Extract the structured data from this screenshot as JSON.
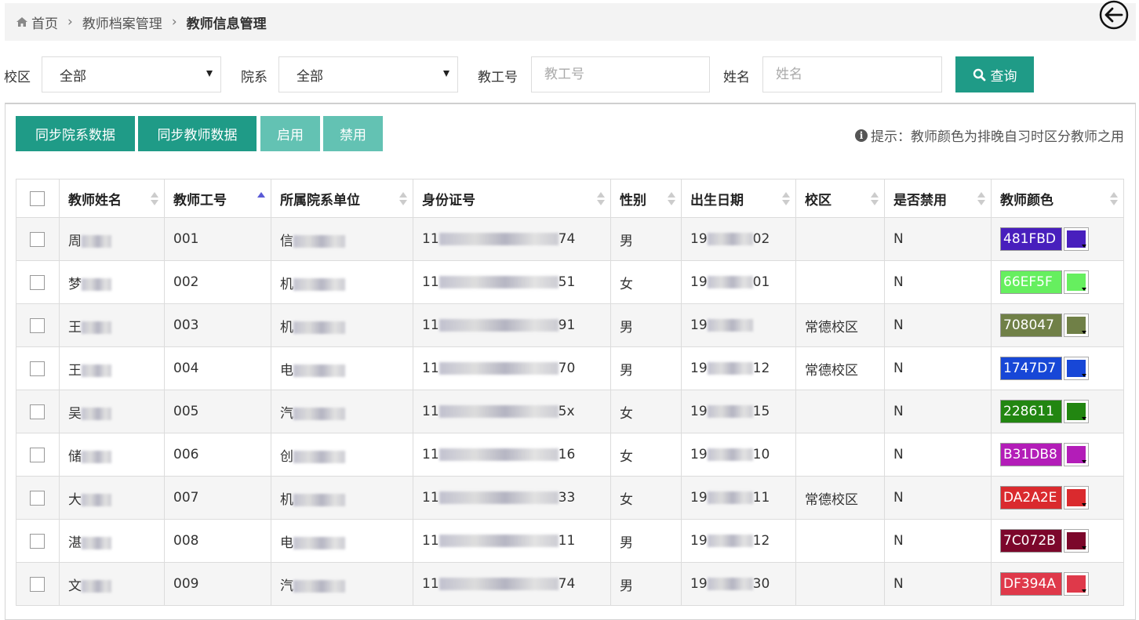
{
  "breadcrumb": {
    "home": "首页",
    "section": "教师档案管理",
    "current": "教师信息管理"
  },
  "filters": {
    "campus_label": "校区",
    "campus_value": "全部",
    "dept_label": "院系",
    "dept_value": "全部",
    "id_label": "教工号",
    "id_placeholder": "教工号",
    "name_label": "姓名",
    "name_placeholder": "姓名",
    "search_label": "查询"
  },
  "toolbar": {
    "sync_dept": "同步院系数据",
    "sync_teacher": "同步教师数据",
    "enable": "启用",
    "disable": "禁用",
    "tip": "提示：教师颜色为排晚自习时区分教师之用"
  },
  "table": {
    "columns": [
      "教师姓名",
      "教师工号",
      "所属院系单位",
      "身份证号",
      "性别",
      "出生日期",
      "校区",
      "是否禁用",
      "教师颜色"
    ],
    "sorted_column": "教师工号",
    "rows": [
      {
        "name": "周",
        "id": "001",
        "dept": "信",
        "idcard_prefix": "11",
        "idcard_suffix": "74",
        "gender": "男",
        "birth_prefix": "19",
        "birth_suffix": "02",
        "campus": "",
        "disabled": "N",
        "color": "481FBD",
        "hex": "#481FBD"
      },
      {
        "name": "梦",
        "id": "002",
        "dept": "机",
        "idcard_prefix": "11",
        "idcard_suffix": "51",
        "gender": "女",
        "birth_prefix": "19",
        "birth_suffix": "01",
        "campus": "",
        "disabled": "N",
        "color": "66EF5F",
        "hex": "#66EF5F"
      },
      {
        "name": "王",
        "id": "003",
        "dept": "机",
        "idcard_prefix": "11",
        "idcard_suffix": "91",
        "gender": "男",
        "birth_prefix": "19",
        "birth_suffix": "",
        "campus": "常德校区",
        "disabled": "N",
        "color": "708047",
        "hex": "#708047"
      },
      {
        "name": "王",
        "id": "004",
        "dept": "电",
        "idcard_prefix": "11",
        "idcard_suffix": "70",
        "gender": "男",
        "birth_prefix": "19",
        "birth_suffix": "12",
        "campus": "常德校区",
        "disabled": "N",
        "color": "1747D7",
        "hex": "#1747D7"
      },
      {
        "name": "吴",
        "id": "005",
        "dept": "汽",
        "idcard_prefix": "11",
        "idcard_suffix": "5x",
        "gender": "女",
        "birth_prefix": "19",
        "birth_suffix": "15",
        "campus": "",
        "disabled": "N",
        "color": "228611",
        "hex": "#228611"
      },
      {
        "name": "储",
        "id": "006",
        "dept": "创",
        "idcard_prefix": "11",
        "idcard_suffix": "16",
        "gender": "女",
        "birth_prefix": "19",
        "birth_suffix": "10",
        "campus": "",
        "disabled": "N",
        "color": "B31DB8",
        "hex": "#B31DB8"
      },
      {
        "name": "大",
        "id": "007",
        "dept": "机",
        "idcard_prefix": "11",
        "idcard_suffix": "33",
        "gender": "女",
        "birth_prefix": "19",
        "birth_suffix": "11",
        "campus": "常德校区",
        "disabled": "N",
        "color": "DA2A2E",
        "hex": "#DA2A2E"
      },
      {
        "name": "湛",
        "id": "008",
        "dept": "电",
        "idcard_prefix": "11",
        "idcard_suffix": "11",
        "gender": "男",
        "birth_prefix": "19",
        "birth_suffix": "12",
        "campus": "",
        "disabled": "N",
        "color": "7C072B",
        "hex": "#7C072B"
      },
      {
        "name": "文",
        "id": "009",
        "dept": "汽",
        "idcard_prefix": "11",
        "idcard_suffix": "74",
        "gender": "男",
        "birth_prefix": "19",
        "birth_suffix": "30",
        "campus": "",
        "disabled": "N",
        "color": "DF394A",
        "hex": "#DF394A"
      }
    ]
  },
  "colors": {
    "primary": "#1f9b87",
    "primary_light": "#63c2b3"
  }
}
